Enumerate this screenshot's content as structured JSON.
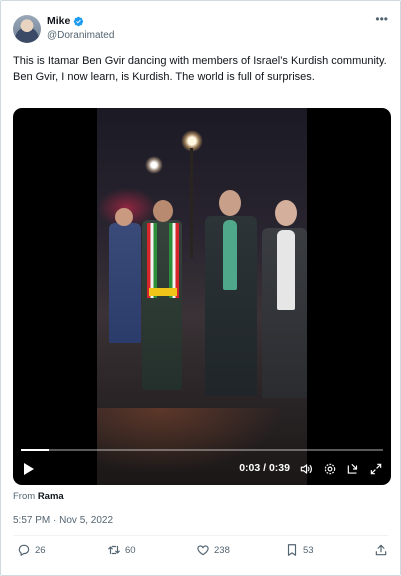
{
  "author": {
    "display_name": "Mike",
    "handle": "@Doranimated",
    "verified": true
  },
  "tweet": {
    "text": "This is Itamar Ben Gvir dancing with members of Israel’s  Kurdish community.  Ben Gvir, I now learn, is Kurdish. The world is full of surprises.",
    "from_prefix": "From",
    "from_source": "Rama",
    "timestamp": "5:57 PM · Nov 5, 2022"
  },
  "video": {
    "time_display": "0:03 / 0:39",
    "progress": 0.077
  },
  "actions": {
    "replies": "26",
    "retweets": "60",
    "likes": "238",
    "bookmarks": "53"
  },
  "colors": {
    "verified": "#1d9bf0",
    "secondary_text": "#536471",
    "primary_text": "#0f1419"
  },
  "icons": [
    "verified-badge-icon",
    "more-options-icon",
    "play-icon",
    "volume-icon",
    "settings-icon",
    "picture-in-picture-icon",
    "fullscreen-icon",
    "reply-icon",
    "retweet-icon",
    "like-icon",
    "bookmark-icon",
    "share-icon"
  ]
}
